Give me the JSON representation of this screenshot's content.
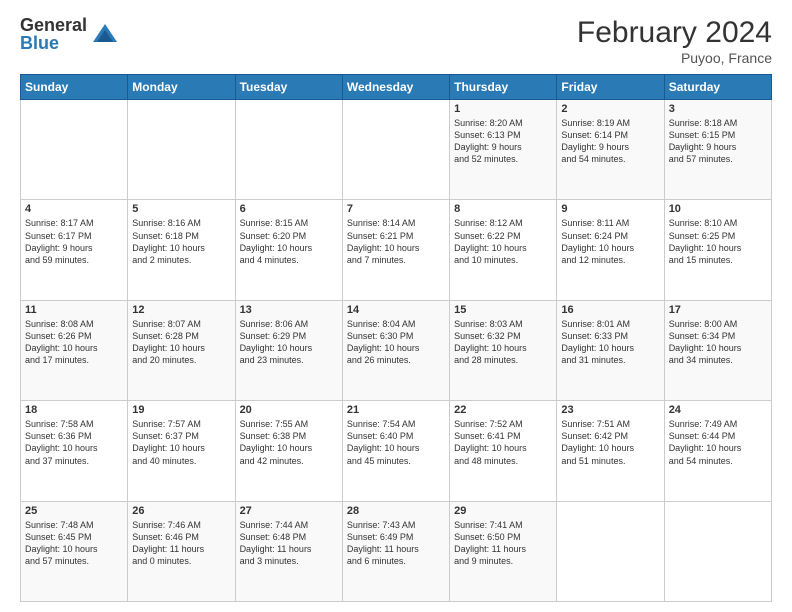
{
  "header": {
    "logo_general": "General",
    "logo_blue": "Blue",
    "title": "February 2024",
    "subtitle": "Puyoo, France"
  },
  "days_of_week": [
    "Sunday",
    "Monday",
    "Tuesday",
    "Wednesday",
    "Thursday",
    "Friday",
    "Saturday"
  ],
  "weeks": [
    [
      {
        "day": "",
        "text": ""
      },
      {
        "day": "",
        "text": ""
      },
      {
        "day": "",
        "text": ""
      },
      {
        "day": "",
        "text": ""
      },
      {
        "day": "1",
        "text": "Sunrise: 8:20 AM\nSunset: 6:13 PM\nDaylight: 9 hours\nand 52 minutes."
      },
      {
        "day": "2",
        "text": "Sunrise: 8:19 AM\nSunset: 6:14 PM\nDaylight: 9 hours\nand 54 minutes."
      },
      {
        "day": "3",
        "text": "Sunrise: 8:18 AM\nSunset: 6:15 PM\nDaylight: 9 hours\nand 57 minutes."
      }
    ],
    [
      {
        "day": "4",
        "text": "Sunrise: 8:17 AM\nSunset: 6:17 PM\nDaylight: 9 hours\nand 59 minutes."
      },
      {
        "day": "5",
        "text": "Sunrise: 8:16 AM\nSunset: 6:18 PM\nDaylight: 10 hours\nand 2 minutes."
      },
      {
        "day": "6",
        "text": "Sunrise: 8:15 AM\nSunset: 6:20 PM\nDaylight: 10 hours\nand 4 minutes."
      },
      {
        "day": "7",
        "text": "Sunrise: 8:14 AM\nSunset: 6:21 PM\nDaylight: 10 hours\nand 7 minutes."
      },
      {
        "day": "8",
        "text": "Sunrise: 8:12 AM\nSunset: 6:22 PM\nDaylight: 10 hours\nand 10 minutes."
      },
      {
        "day": "9",
        "text": "Sunrise: 8:11 AM\nSunset: 6:24 PM\nDaylight: 10 hours\nand 12 minutes."
      },
      {
        "day": "10",
        "text": "Sunrise: 8:10 AM\nSunset: 6:25 PM\nDaylight: 10 hours\nand 15 minutes."
      }
    ],
    [
      {
        "day": "11",
        "text": "Sunrise: 8:08 AM\nSunset: 6:26 PM\nDaylight: 10 hours\nand 17 minutes."
      },
      {
        "day": "12",
        "text": "Sunrise: 8:07 AM\nSunset: 6:28 PM\nDaylight: 10 hours\nand 20 minutes."
      },
      {
        "day": "13",
        "text": "Sunrise: 8:06 AM\nSunset: 6:29 PM\nDaylight: 10 hours\nand 23 minutes."
      },
      {
        "day": "14",
        "text": "Sunrise: 8:04 AM\nSunset: 6:30 PM\nDaylight: 10 hours\nand 26 minutes."
      },
      {
        "day": "15",
        "text": "Sunrise: 8:03 AM\nSunset: 6:32 PM\nDaylight: 10 hours\nand 28 minutes."
      },
      {
        "day": "16",
        "text": "Sunrise: 8:01 AM\nSunset: 6:33 PM\nDaylight: 10 hours\nand 31 minutes."
      },
      {
        "day": "17",
        "text": "Sunrise: 8:00 AM\nSunset: 6:34 PM\nDaylight: 10 hours\nand 34 minutes."
      }
    ],
    [
      {
        "day": "18",
        "text": "Sunrise: 7:58 AM\nSunset: 6:36 PM\nDaylight: 10 hours\nand 37 minutes."
      },
      {
        "day": "19",
        "text": "Sunrise: 7:57 AM\nSunset: 6:37 PM\nDaylight: 10 hours\nand 40 minutes."
      },
      {
        "day": "20",
        "text": "Sunrise: 7:55 AM\nSunset: 6:38 PM\nDaylight: 10 hours\nand 42 minutes."
      },
      {
        "day": "21",
        "text": "Sunrise: 7:54 AM\nSunset: 6:40 PM\nDaylight: 10 hours\nand 45 minutes."
      },
      {
        "day": "22",
        "text": "Sunrise: 7:52 AM\nSunset: 6:41 PM\nDaylight: 10 hours\nand 48 minutes."
      },
      {
        "day": "23",
        "text": "Sunrise: 7:51 AM\nSunset: 6:42 PM\nDaylight: 10 hours\nand 51 minutes."
      },
      {
        "day": "24",
        "text": "Sunrise: 7:49 AM\nSunset: 6:44 PM\nDaylight: 10 hours\nand 54 minutes."
      }
    ],
    [
      {
        "day": "25",
        "text": "Sunrise: 7:48 AM\nSunset: 6:45 PM\nDaylight: 10 hours\nand 57 minutes."
      },
      {
        "day": "26",
        "text": "Sunrise: 7:46 AM\nSunset: 6:46 PM\nDaylight: 11 hours\nand 0 minutes."
      },
      {
        "day": "27",
        "text": "Sunrise: 7:44 AM\nSunset: 6:48 PM\nDaylight: 11 hours\nand 3 minutes."
      },
      {
        "day": "28",
        "text": "Sunrise: 7:43 AM\nSunset: 6:49 PM\nDaylight: 11 hours\nand 6 minutes."
      },
      {
        "day": "29",
        "text": "Sunrise: 7:41 AM\nSunset: 6:50 PM\nDaylight: 11 hours\nand 9 minutes."
      },
      {
        "day": "",
        "text": ""
      },
      {
        "day": "",
        "text": ""
      }
    ]
  ]
}
